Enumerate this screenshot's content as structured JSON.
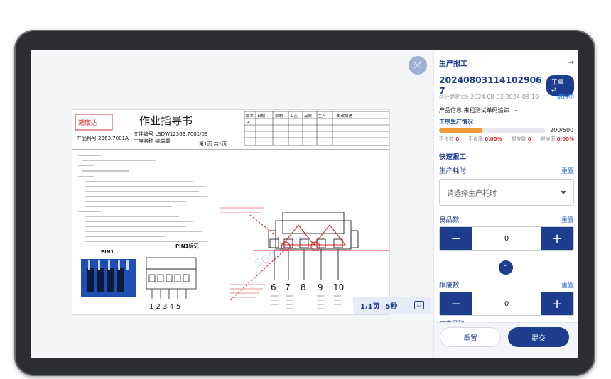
{
  "document": {
    "title": "作业指导书",
    "company": "潮康达",
    "file_no_label": "文件编号",
    "file_no": "LSDW12363.7001/09",
    "product_label": "产品料号",
    "product_no": "2363.7001A",
    "process_label": "工序名称",
    "process_name": "绕端脚",
    "page_info": "第1页 共1页",
    "rev_headers": [
      "版本",
      "日期",
      "拟制",
      "工艺",
      "品质",
      "生产",
      "更改描述"
    ],
    "rev_first": "A",
    "pin1_label": "PIN1",
    "pin1_mark_label": "PIN1标记",
    "pins_right": [
      "6",
      "7",
      "8",
      "9",
      "10"
    ],
    "pins_left": "1 2 3 4 5",
    "watermark": "SG生产报工"
  },
  "pager": {
    "page": "1/1页",
    "interval": "5秒"
  },
  "panel": {
    "title": "生产报工",
    "order_no": "20240803114102906​7",
    "order_btn": "工单⇌",
    "plan_time": "◎计划时间: 2024-08-03-2024-08-10",
    "status": "进行中",
    "product_info": "产品信息  来租测试单码追踪 | -",
    "progress_label": "工序生产情况",
    "progress": 0.4,
    "progress_text": "200/500",
    "stats": {
      "bad_label": "不良数",
      "bad": "0",
      "bad_rate_label": "不良率",
      "bad_rate": "0.00%",
      "scrap_label": "报废数",
      "scrap": "0",
      "scrap_rate_label": "报废率",
      "scrap_rate": "0.00%"
    },
    "quick_title": "快速报工",
    "time_label": "生产耗时",
    "time_placeholder": "请选择生产耗时",
    "reset_label": "重置",
    "good_label": "良品数",
    "good_value": "0",
    "scrap_count_label": "报废数",
    "scrap_count_value": "0",
    "cut_label": "工序号码",
    "reset_btn": "重置",
    "submit_btn": "提交"
  }
}
